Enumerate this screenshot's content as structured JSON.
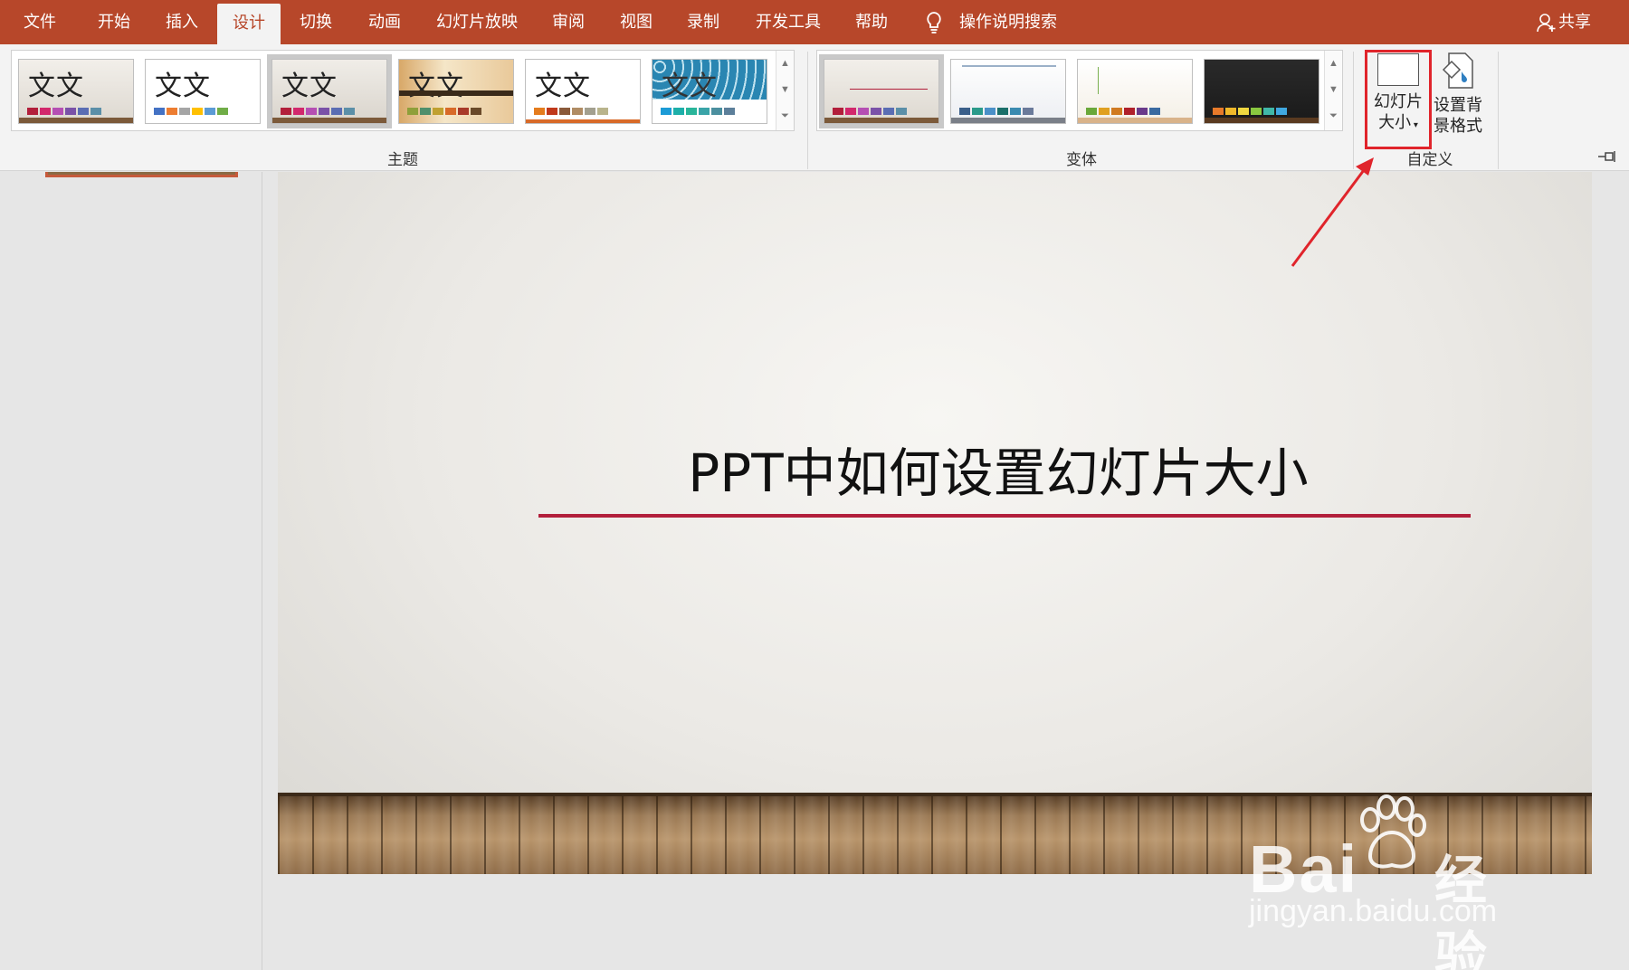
{
  "tabs": [
    {
      "label": "文件"
    },
    {
      "label": "开始"
    },
    {
      "label": "插入"
    },
    {
      "label": "设计"
    },
    {
      "label": "切换"
    },
    {
      "label": "动画"
    },
    {
      "label": "幻灯片放映"
    },
    {
      "label": "审阅"
    },
    {
      "label": "视图"
    },
    {
      "label": "录制"
    },
    {
      "label": "开发工具"
    },
    {
      "label": "帮助"
    }
  ],
  "active_tab": "设计",
  "search": {
    "label": "操作说明搜索"
  },
  "share": {
    "label": "共享"
  },
  "themes": {
    "label": "主题",
    "items": [
      {
        "text": "文文"
      },
      {
        "text": "文文"
      },
      {
        "text": "文文"
      },
      {
        "text": "文文"
      },
      {
        "text": "文文"
      },
      {
        "text": "文文"
      }
    ]
  },
  "variants": {
    "label": "变体"
  },
  "customize": {
    "label": "自定义",
    "slide_size_line1": "幻灯片",
    "slide_size_line2": "大小",
    "bg_format_line1": "设置背",
    "bg_format_line2": "景格式"
  },
  "slide": {
    "title": "PPT中如何设置幻灯片大小"
  },
  "watermark": {
    "brand": "Bai",
    "brand2": "经验",
    "url": "jingyan.baidu.com"
  },
  "colors": {
    "accent": "#b7472a",
    "highlight": "#e0242b",
    "title_rule": "#b21f3b"
  }
}
